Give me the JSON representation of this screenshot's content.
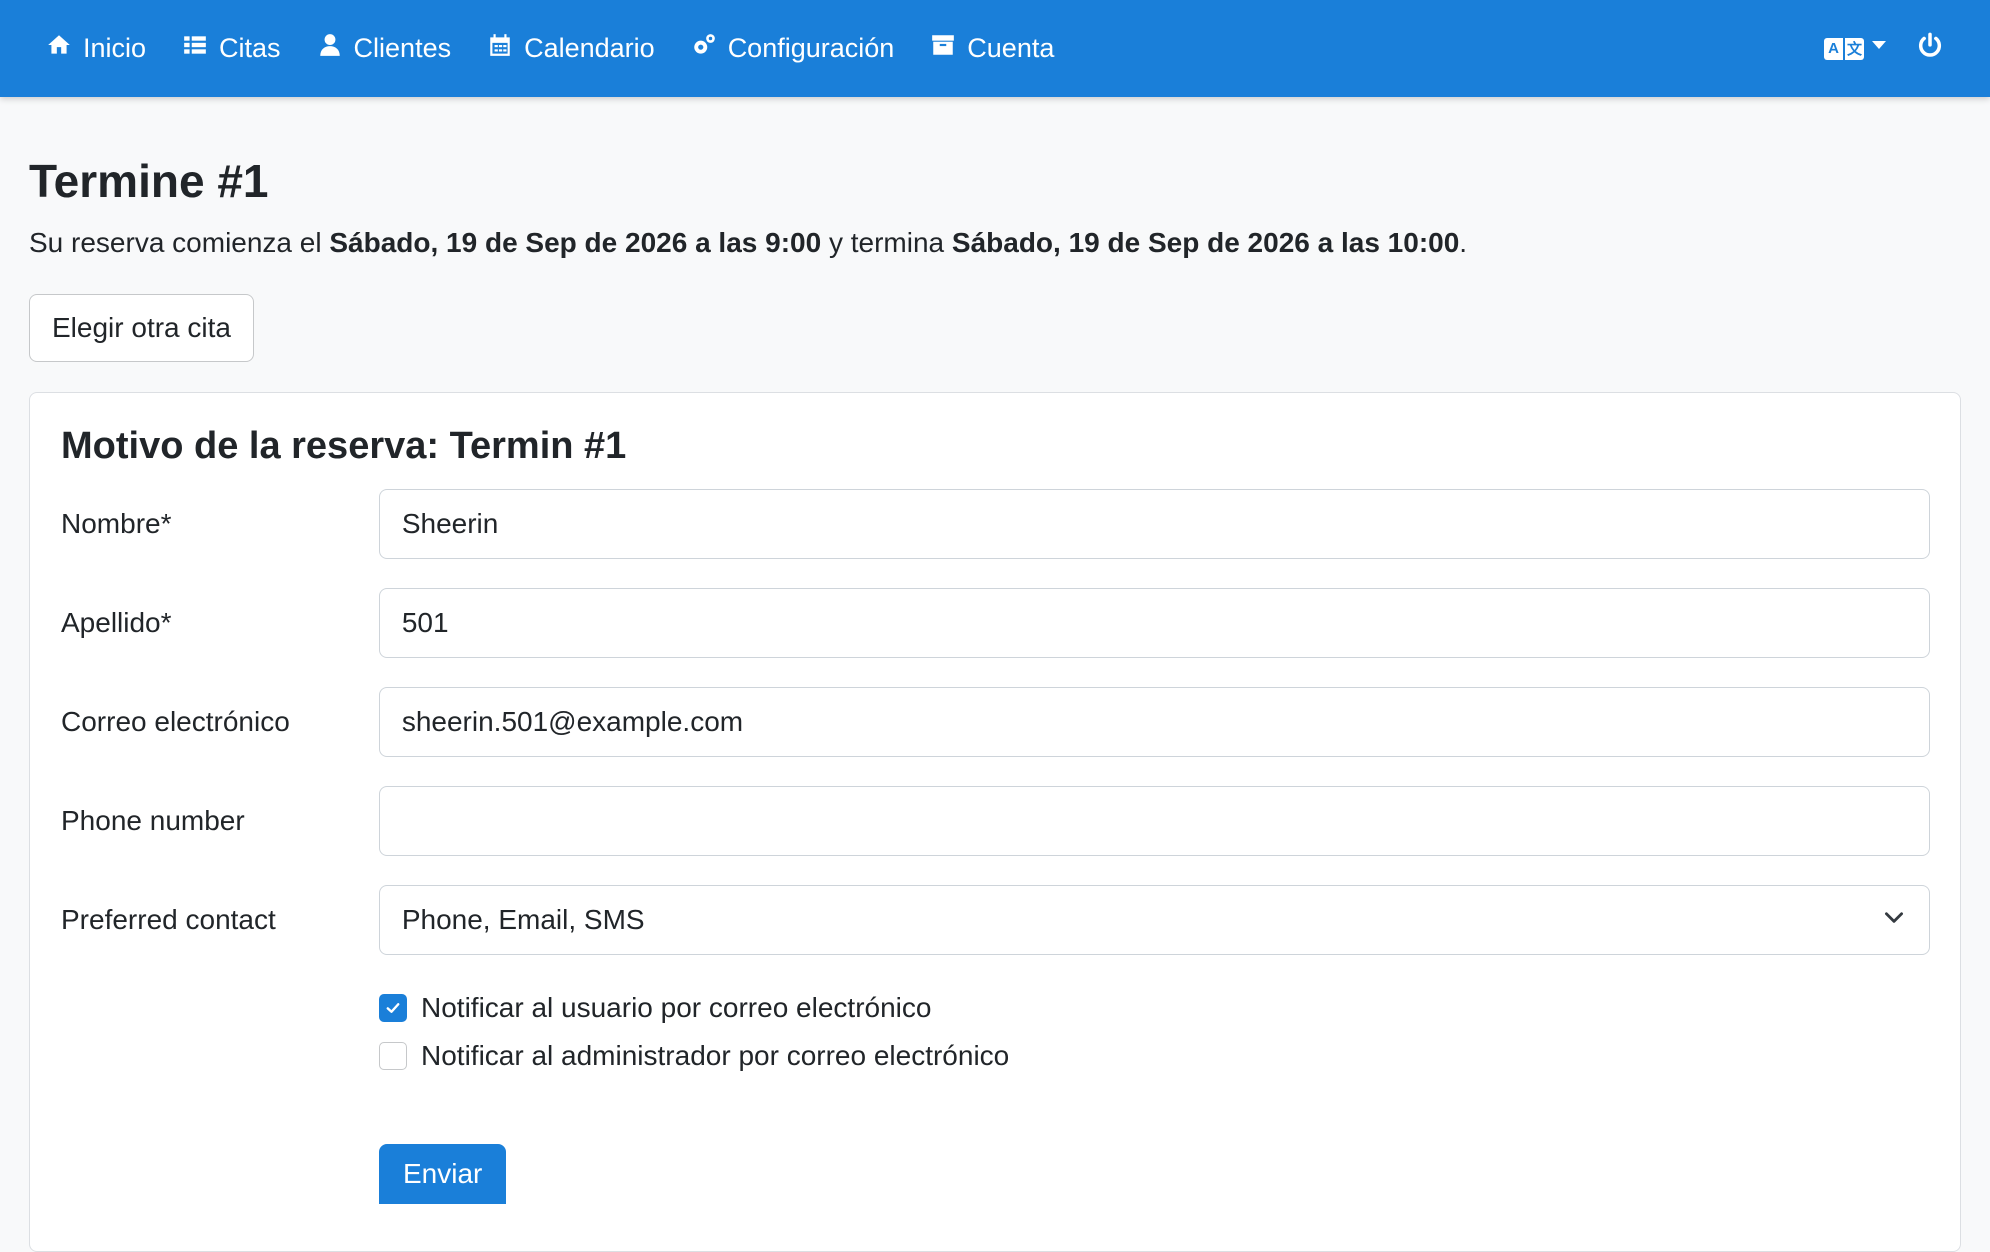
{
  "nav": {
    "items": [
      {
        "label": "Inicio",
        "icon": "home-icon"
      },
      {
        "label": "Citas",
        "icon": "list-icon"
      },
      {
        "label": "Clientes",
        "icon": "user-icon"
      },
      {
        "label": "Calendario",
        "icon": "calendar-icon"
      },
      {
        "label": "Configuración",
        "icon": "gears-icon"
      },
      {
        "label": "Cuenta",
        "icon": "archive-icon"
      }
    ],
    "language_icon": "language-icon",
    "power_icon": "power-icon",
    "bar_color": "#1a7fd9"
  },
  "page": {
    "title": "Termine #1",
    "intro_prefix": "Su reserva comienza el",
    "start": "Sábado, 19 de Sep de 2026 a las 9:00",
    "intro_middle": "y termina",
    "end": "Sábado, 19 de Sep de 2026 a las 10:00",
    "intro_suffix": ".",
    "other_button": "Elegir otra cita"
  },
  "form": {
    "title": "Motivo de la reserva: Termin #1",
    "fields": [
      {
        "label": "Nombre*",
        "value": "Sheerin"
      },
      {
        "label": "Apellido*",
        "value": "501"
      },
      {
        "label": "Correo electrónico",
        "value": "sheerin.501@example.com"
      },
      {
        "label": "Phone number",
        "value": ""
      }
    ],
    "preferred_contact": {
      "label": "Preferred contact",
      "value": "Phone, Email, SMS"
    },
    "checkboxes": [
      {
        "label": "Notificar al usuario por correo electrónico",
        "checked": true
      },
      {
        "label": "Notificar al administrador por correo electrónico",
        "checked": false
      }
    ],
    "submit_label": "Enviar"
  }
}
